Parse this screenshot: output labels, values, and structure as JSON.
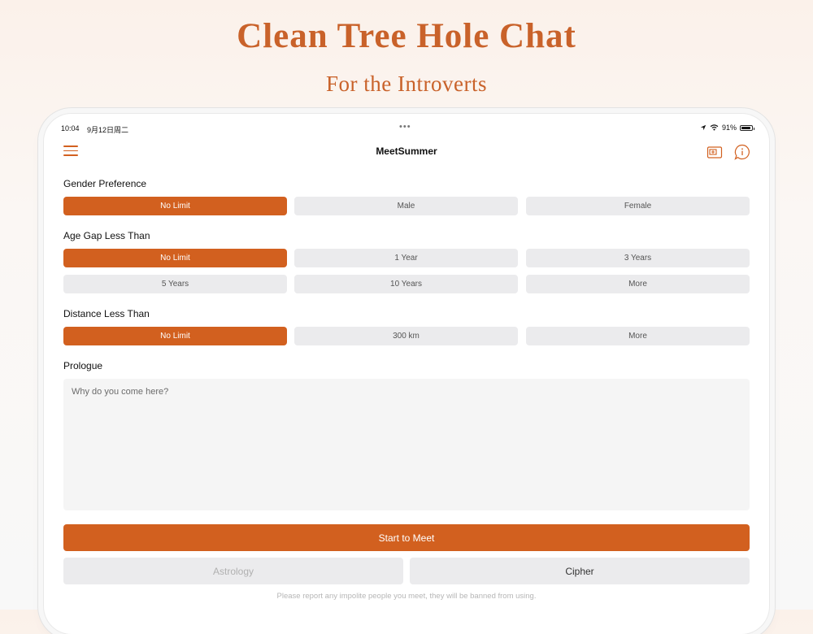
{
  "marketing": {
    "title": "Clean Tree Hole Chat",
    "subtitle": "For the Introverts"
  },
  "status_bar": {
    "time": "10:04",
    "date": "9月12日周二",
    "dots": "•••",
    "battery_percent": "91%",
    "battery_level": 0.91
  },
  "nav": {
    "title": "MeetSummer",
    "icons": [
      "menu-icon",
      "photo-icon",
      "info-bubble-icon"
    ]
  },
  "gender": {
    "label": "Gender Preference",
    "options": [
      "No Limit",
      "Male",
      "Female"
    ],
    "selected": "No Limit"
  },
  "age_gap": {
    "label": "Age Gap Less Than",
    "options": [
      "No Limit",
      "1 Year",
      "3 Years",
      "5 Years",
      "10 Years",
      "More"
    ],
    "selected": "No Limit"
  },
  "distance": {
    "label": "Distance Less Than",
    "options": [
      "No Limit",
      "300 km",
      "More"
    ],
    "selected": "No Limit"
  },
  "prologue": {
    "label": "Prologue",
    "placeholder": "Why do you come here?"
  },
  "actions": {
    "start": "Start to Meet",
    "astrology": "Astrology",
    "cipher": "Cipher"
  },
  "footer": "Please report any impolite people you meet, they will be banned from using.",
  "colors": {
    "accent": "#d2601f",
    "option_bg": "#ebebed",
    "text_area_bg": "#f5f5f5"
  }
}
